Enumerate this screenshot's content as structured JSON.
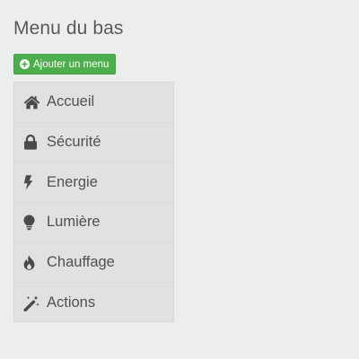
{
  "header": {
    "title": "Menu du bas"
  },
  "toolbar": {
    "add_menu_label": "Ajouter un menu"
  },
  "colors": {
    "background": "#eceeed",
    "accent_green": "#4cae4c",
    "panel": "#e0e1e0",
    "icon": "#4a4a4a"
  },
  "menu": {
    "items": [
      {
        "label": "Accueil",
        "icon": "home-icon"
      },
      {
        "label": "Sécurité",
        "icon": "lock-icon"
      },
      {
        "label": "Energie",
        "icon": "bolt-icon"
      },
      {
        "label": "Lumière",
        "icon": "lightbulb-icon"
      },
      {
        "label": "Chauffage",
        "icon": "flame-icon"
      },
      {
        "label": "Actions",
        "icon": "magic-wand-icon"
      }
    ]
  }
}
